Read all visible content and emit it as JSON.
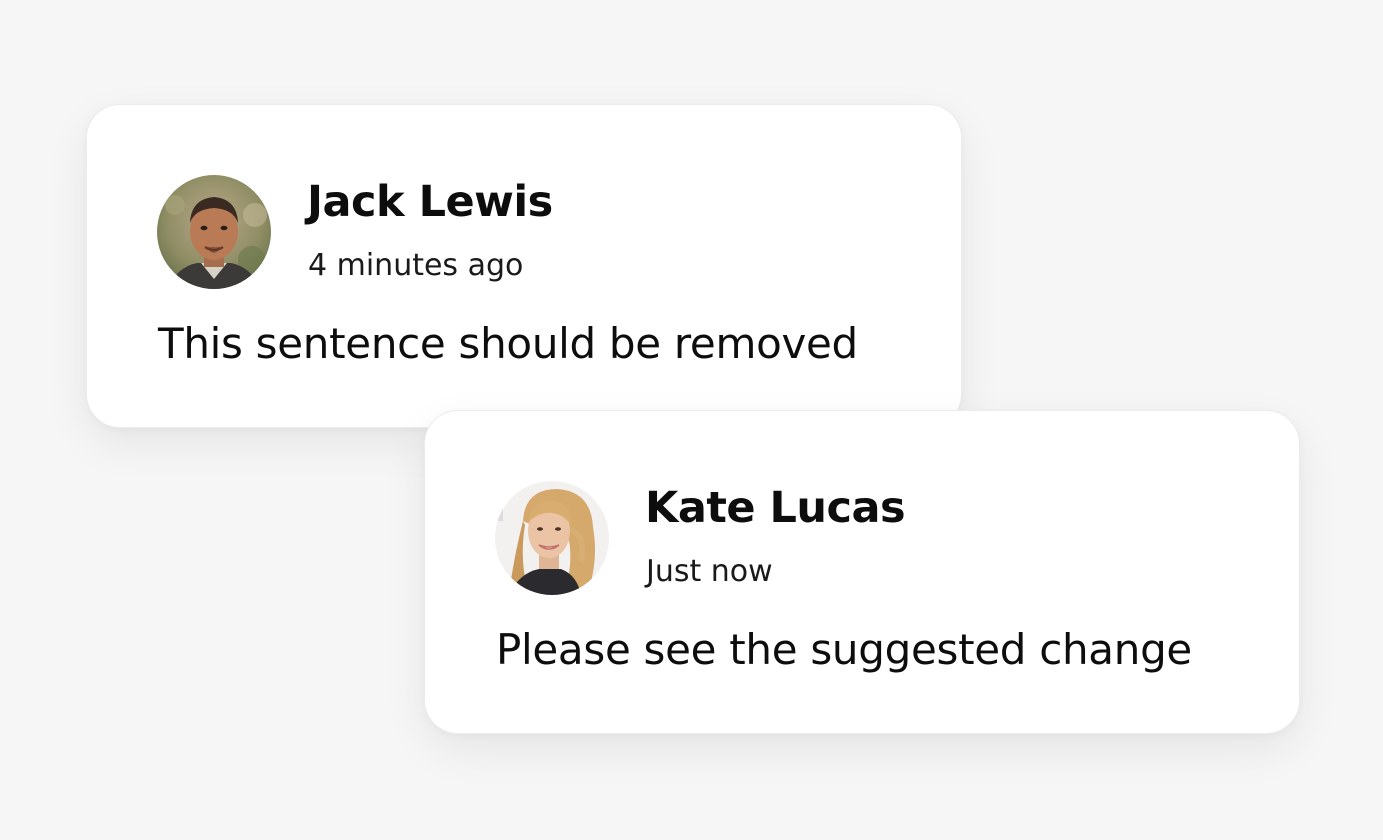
{
  "comments": [
    {
      "author": "Jack Lewis",
      "time": "4 minutes ago",
      "text": "This sentence should be removed",
      "avatar_icon": "man-portrait-avatar"
    },
    {
      "author": "Kate Lucas",
      "time": "Just now",
      "text": "Please see the suggested change",
      "avatar_icon": "woman-portrait-avatar"
    }
  ],
  "colors": {
    "background": "#f6f6f6",
    "card": "#ffffff",
    "text": "#0d0d0d"
  }
}
